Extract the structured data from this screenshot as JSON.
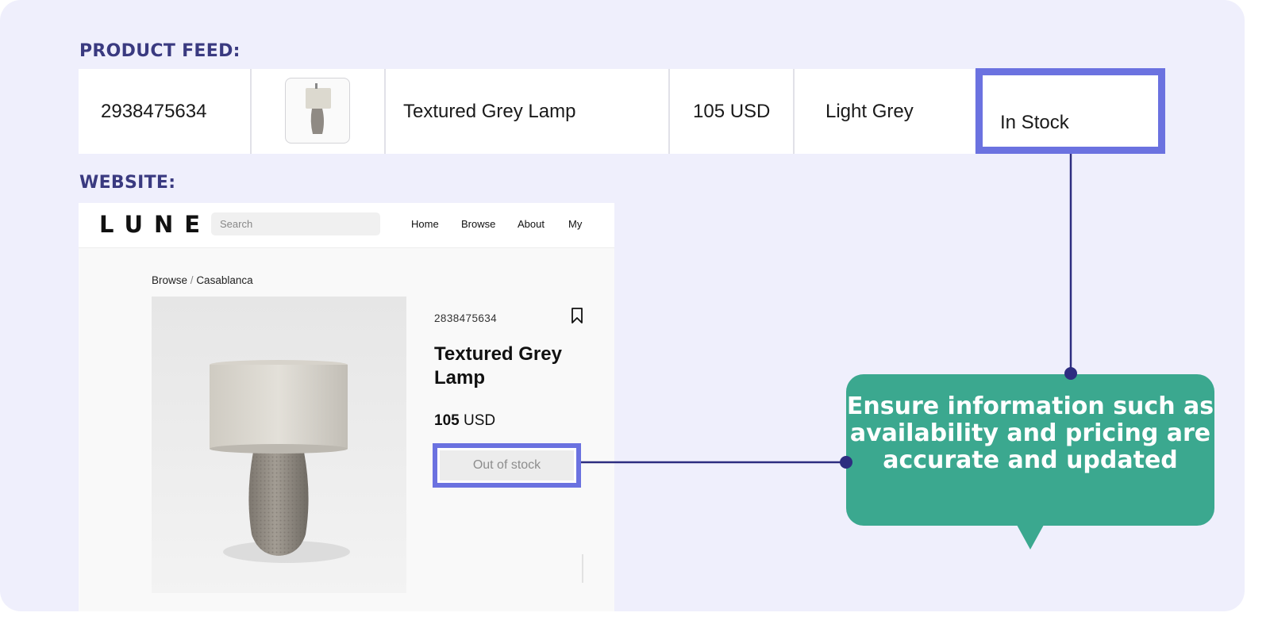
{
  "labels": {
    "product_feed": "PRODUCT FEED:",
    "website": "WEBSITE:"
  },
  "feed": {
    "id": "2938475634",
    "title": "Textured Grey Lamp",
    "price": "105 USD",
    "color": "Light Grey",
    "availability": "In Stock"
  },
  "website": {
    "logo": "LUNE",
    "search_placeholder": "Search",
    "nav": [
      "Home",
      "Browse",
      "About",
      "My"
    ],
    "breadcrumb": {
      "parent": "Browse",
      "separator": "/",
      "current": "Casablanca"
    },
    "sku": "2838475634",
    "product_name": "Textured Grey Lamp",
    "price_amount": "105",
    "price_currency": "USD",
    "stock_status": "Out of stock"
  },
  "callout": {
    "text": "Ensure information such as availability and pricing are accurate and updated"
  },
  "colors": {
    "background": "#efeffc",
    "label": "#3a3a80",
    "highlight": "#6b72e0",
    "callout": "#3ba88f",
    "connector": "#2d2d80"
  },
  "icons": [
    "lamp-thumbnail",
    "bookmark-icon",
    "lamp-photo"
  ]
}
